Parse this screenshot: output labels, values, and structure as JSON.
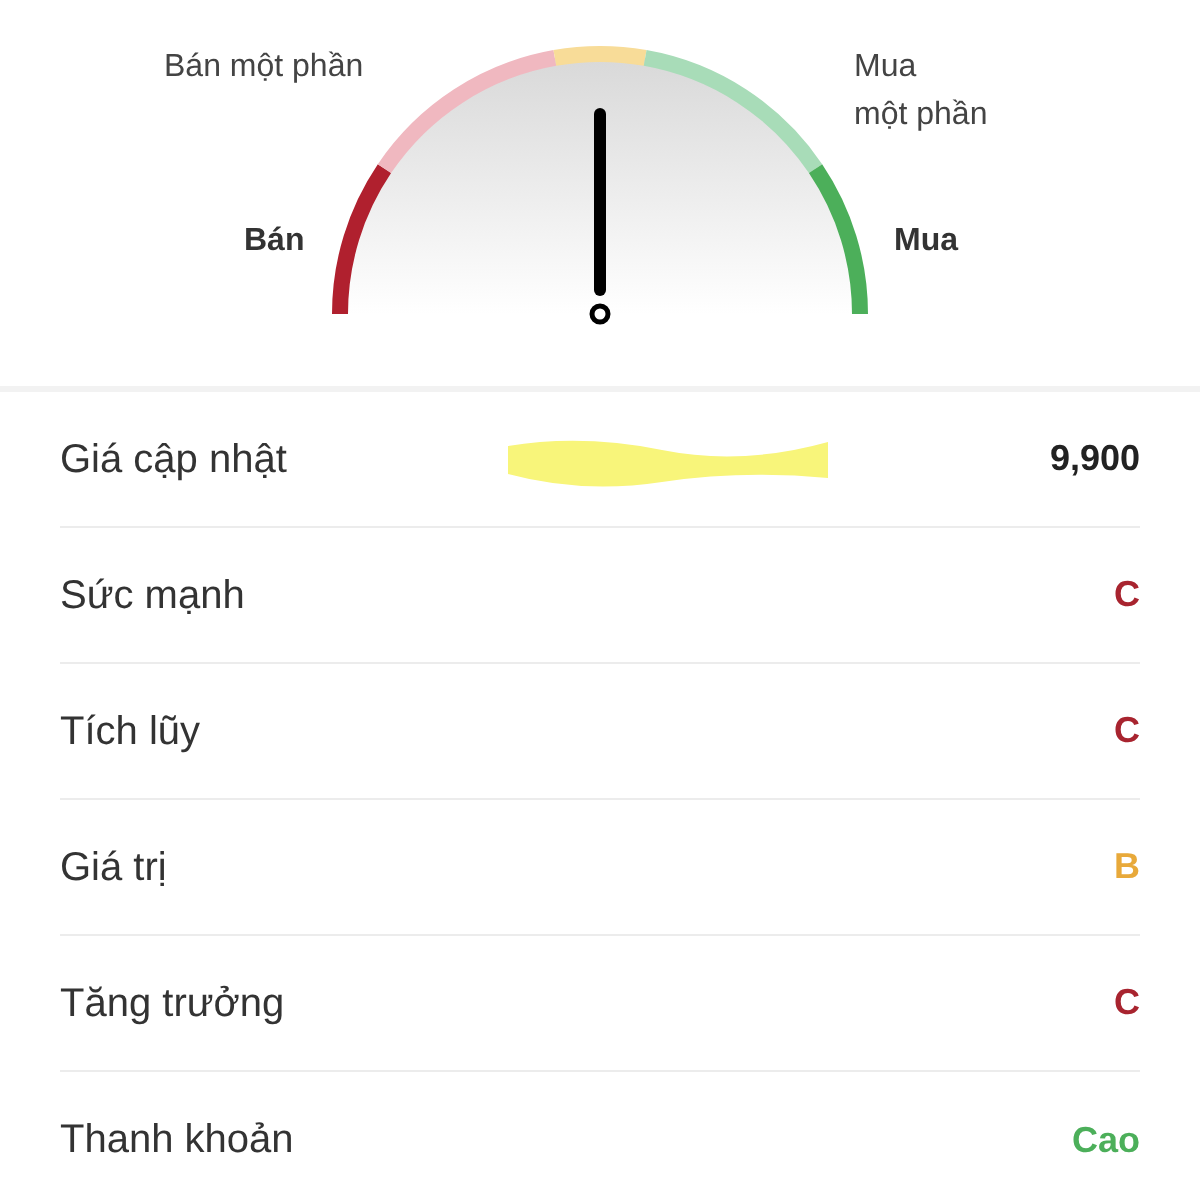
{
  "gauge": {
    "level": 0.5,
    "segments": [
      {
        "color": "#b0202e"
      },
      {
        "color": "#f0b8c0"
      },
      {
        "color": "#f8dc98"
      },
      {
        "color": "#a8dcb8"
      },
      {
        "color": "#4caf5a"
      }
    ],
    "labels": [
      {
        "text": "Bán một phần",
        "kind": "upper-left"
      },
      {
        "text": "Mua\nmột phần",
        "kind": "upper-right"
      },
      {
        "text": "Bán",
        "kind": "lower-left"
      },
      {
        "text": "Mua",
        "kind": "lower-right"
      }
    ]
  },
  "rows": [
    {
      "label": "Giá cập nhật",
      "value": "9,900",
      "color": "#222222",
      "highlight": true
    },
    {
      "label": "Sức mạnh",
      "value": "C",
      "color": "#a8242f",
      "highlight": false
    },
    {
      "label": "Tích lũy",
      "value": "C",
      "color": "#a8242f",
      "highlight": false
    },
    {
      "label": "Giá trị",
      "value": "B",
      "color": "#e8a93a",
      "highlight": false
    },
    {
      "label": "Tăng trưởng",
      "value": "C",
      "color": "#a8242f",
      "highlight": false
    },
    {
      "label": "Thanh khoản",
      "value": "Cao",
      "color": "#4caf5a",
      "highlight": false
    }
  ]
}
